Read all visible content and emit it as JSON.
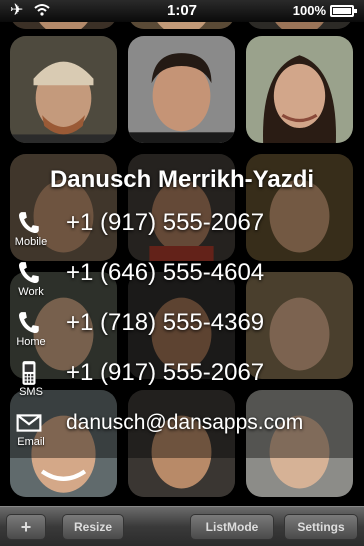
{
  "status_bar": {
    "icons": [
      "airplane-icon",
      "wifi-icon"
    ],
    "time": "1:07",
    "battery": "100%"
  },
  "contact": {
    "name": "Danusch Merrikh-Yazdi",
    "entries": [
      {
        "icon": "phone-icon",
        "label": "Mobile",
        "value": "+1 (917) 555-2067"
      },
      {
        "icon": "phone-icon",
        "label": "Work",
        "value": "+1 (646) 555-4604"
      },
      {
        "icon": "phone-icon",
        "label": "Home",
        "value": "+1 (718) 555-4369"
      },
      {
        "icon": "sms-phone-icon",
        "label": "SMS",
        "value": "+1 (917) 555-2067"
      },
      {
        "icon": "envelope-icon",
        "label": "Email",
        "value": "danusch@dansapps.com"
      }
    ]
  },
  "toolbar": {
    "add_label": "+",
    "resize_label": "Resize",
    "listmode_label": "ListMode",
    "settings_label": "Settings"
  },
  "colors": {
    "background": "#000000",
    "toolbar": "#4a4a4a",
    "text": "#ffffff"
  }
}
